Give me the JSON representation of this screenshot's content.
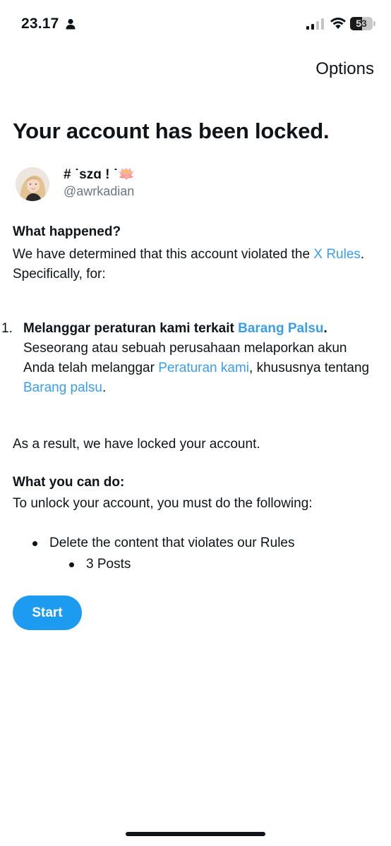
{
  "status_bar": {
    "time": "23.17",
    "battery_level": "53"
  },
  "header": {
    "options_label": "Options"
  },
  "page": {
    "title": "Your account has been locked."
  },
  "account": {
    "display_name": "# ˙szɑ ! ˙🪷",
    "handle": "@awrkadian"
  },
  "what_happened": {
    "heading": "What happened?",
    "text_before": "We have determined that this account violated the ",
    "rules_link_1": "X",
    "rules_link_2": "Rules",
    "text_after": ". Specifically, for:"
  },
  "violations": [
    {
      "number": "1.",
      "title_before": "Melanggar peraturan kami terkait ",
      "title_link": "Barang Palsu",
      "title_after": ".",
      "desc_before": "Seseorang atau sebuah perusahaan melaporkan akun Anda telah melanggar ",
      "desc_link_1": "Peraturan kami",
      "desc_middle": ", khususnya tentang ",
      "desc_link_2": "Barang palsu",
      "desc_after": "."
    }
  ],
  "result_text": "As a result, we have locked your account.",
  "what_you_can_do": {
    "heading": "What you can do:",
    "text": "To unlock your account, you must do the following:",
    "items": [
      {
        "label": "Delete the content that violates our Rules",
        "subitems": [
          "3 Posts"
        ]
      }
    ]
  },
  "actions": {
    "start_label": "Start"
  }
}
